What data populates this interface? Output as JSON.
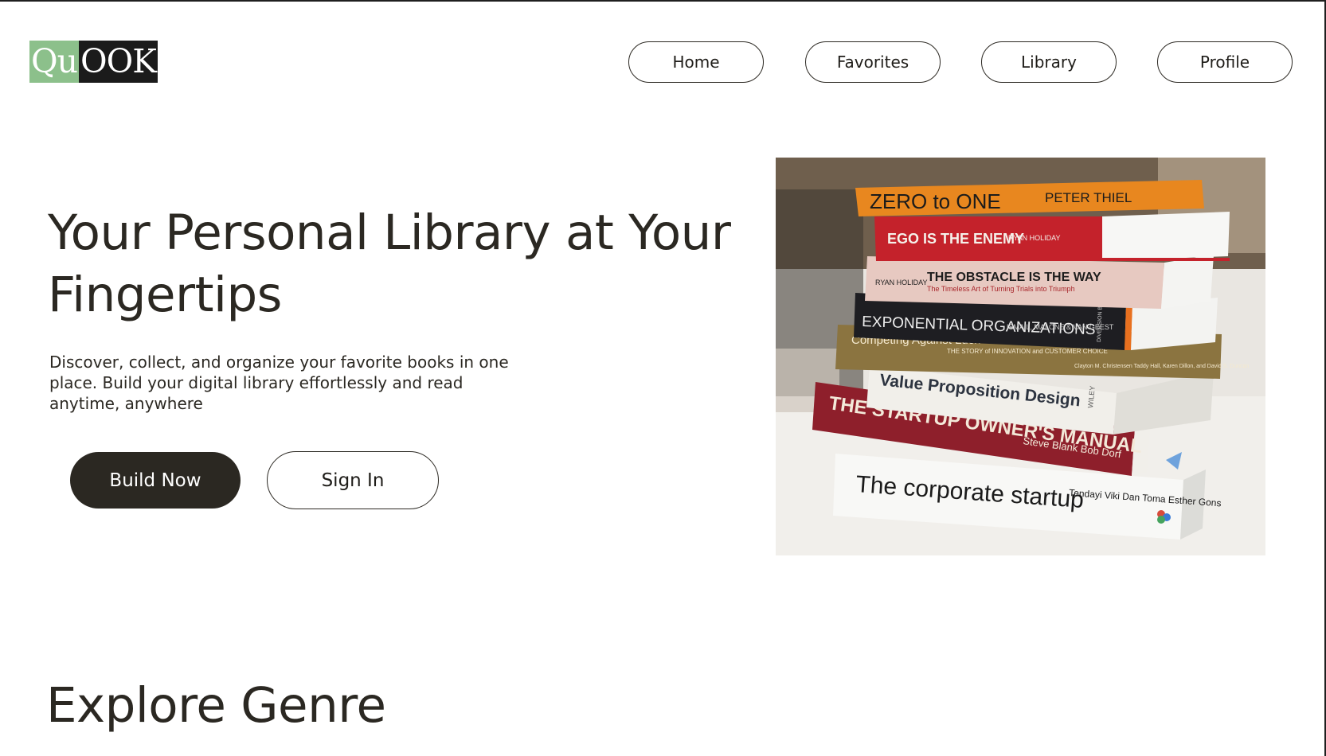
{
  "brand": {
    "logo_part_a": "Qu",
    "logo_part_b": "OOK"
  },
  "nav": {
    "items": [
      {
        "label": "Home"
      },
      {
        "label": "Favorites"
      },
      {
        "label": "Library"
      },
      {
        "label": "Profile"
      }
    ]
  },
  "hero": {
    "title": "Your Personal Library at Your Fingertips",
    "description": "Discover, collect, and organize your favorite books in one place. Build your digital library effortlessly and read anytime, anywhere",
    "primary_button": "Build Now",
    "secondary_button": "Sign In"
  },
  "hero_image": {
    "books": [
      {
        "title": "ZERO to ONE",
        "author": "PETER THIEL",
        "color": "#e8871f"
      },
      {
        "title": "EGO IS THE ENEMY",
        "author": "RYAN HOLIDAY",
        "color": "#c4222b"
      },
      {
        "title": "THE OBSTACLE IS THE WAY",
        "subtitle": "The Timeless Art of Turning Trials into Triumph",
        "author": "RYAN HOLIDAY",
        "color": "#e7c9c1"
      },
      {
        "title": "EXPONENTIAL ORGANIZATIONS",
        "author": "ISMAIL, MALONE & VAN GEEST",
        "publisher": "DIVERSION BOOKS",
        "color": "#1e1e22"
      },
      {
        "title": "Competing Against Luck",
        "subtitle": "THE STORY of INNOVATION and CUSTOMER CHOICE",
        "author": "Clayton M. Christensen Taddy Hall, Karen Dillon, and David S. Duncan",
        "color": "#8b7440"
      },
      {
        "title": "Value Proposition Design",
        "publisher": "WILEY",
        "color": "#f1efea"
      },
      {
        "title": "THE STARTUP OWNER'S MANUAL",
        "author": "Steve Blank Bob Dorf",
        "color": "#8e1f2b"
      },
      {
        "title": "The corporate startup",
        "author": "Tendayi Viki Dan Toma Esther Gons",
        "color": "#f6f6f4"
      }
    ]
  },
  "explore": {
    "title": "Explore Genre"
  }
}
